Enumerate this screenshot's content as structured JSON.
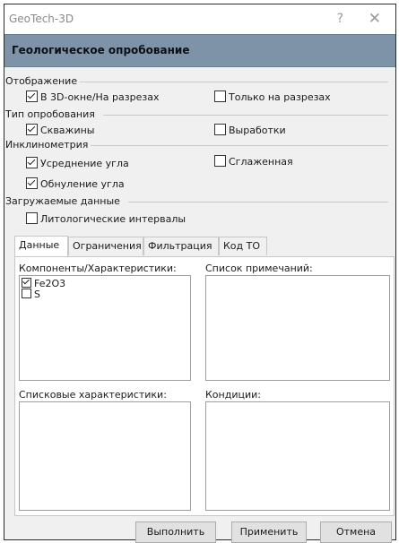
{
  "window": {
    "title": "GeoTech-3D",
    "help_symbol": "?",
    "close_symbol": "✕"
  },
  "header": {
    "title": "Геологическое опробование"
  },
  "sections": {
    "display": {
      "label": "Отображение",
      "options": [
        {
          "label": "В 3D-окне/На разрезах",
          "checked": true
        },
        {
          "label": "Только на разрезах",
          "checked": false
        }
      ]
    },
    "sampling_type": {
      "label": "Тип опробования",
      "options": [
        {
          "label": "Скважины",
          "checked": true
        },
        {
          "label": "Выработки",
          "checked": false
        }
      ]
    },
    "inclinometry": {
      "label": "Инклинометрия",
      "options": [
        {
          "label": "Усреднение угла",
          "checked": true
        },
        {
          "label": "Сглаженная",
          "checked": false
        },
        {
          "label": "Обнуление угла",
          "checked": true
        }
      ]
    },
    "loaded_data": {
      "label": "Загружаемые данные",
      "options": [
        {
          "label": "Литологические интервалы",
          "checked": false
        }
      ]
    }
  },
  "tabs": [
    {
      "label": "Данные",
      "active": true
    },
    {
      "label": "Ограничения",
      "active": false
    },
    {
      "label": "Фильтрация",
      "active": false
    },
    {
      "label": "Код ТО",
      "active": false
    }
  ],
  "panel": {
    "components_label": "Компоненты/Характеристики:",
    "components": [
      {
        "label": "Fe2O3",
        "checked": true
      },
      {
        "label": "S",
        "checked": false
      }
    ],
    "notes_label": "Список примечаний:",
    "list_chars_label": "Списковые характеристики:",
    "conditions_label": "Кондиции:"
  },
  "buttons": {
    "execute": "Выполнить",
    "apply": "Применить",
    "cancel": "Отмена"
  }
}
